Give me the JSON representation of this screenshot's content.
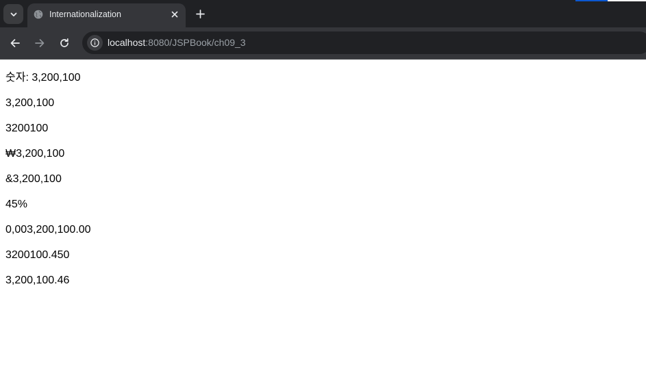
{
  "browser": {
    "tab": {
      "title": "Internationalization",
      "favicon": "globe-icon",
      "close_icon": "close-icon"
    },
    "tab_search_icon": "chevron-down-icon",
    "new_tab_icon": "plus-icon",
    "toolbar": {
      "back_icon": "arrow-left-icon",
      "forward_icon": "arrow-right-icon",
      "reload_icon": "reload-icon",
      "site_info_icon": "info-icon"
    },
    "address_bar": {
      "host": "localhost",
      "rest": ":8080/JSPBook/ch09_3"
    },
    "colors": {
      "frame": "#202124",
      "toolbar": "#35363a",
      "omnibox": "#202124",
      "accent": "#0b57d0"
    }
  },
  "page": {
    "lines": [
      "숫자: 3,200,100",
      "3,200,100",
      "3200100",
      "₩3,200,100",
      "&3,200,100",
      "45%",
      "0,003,200,100.00",
      "3200100.450",
      "3,200,100.46"
    ]
  }
}
